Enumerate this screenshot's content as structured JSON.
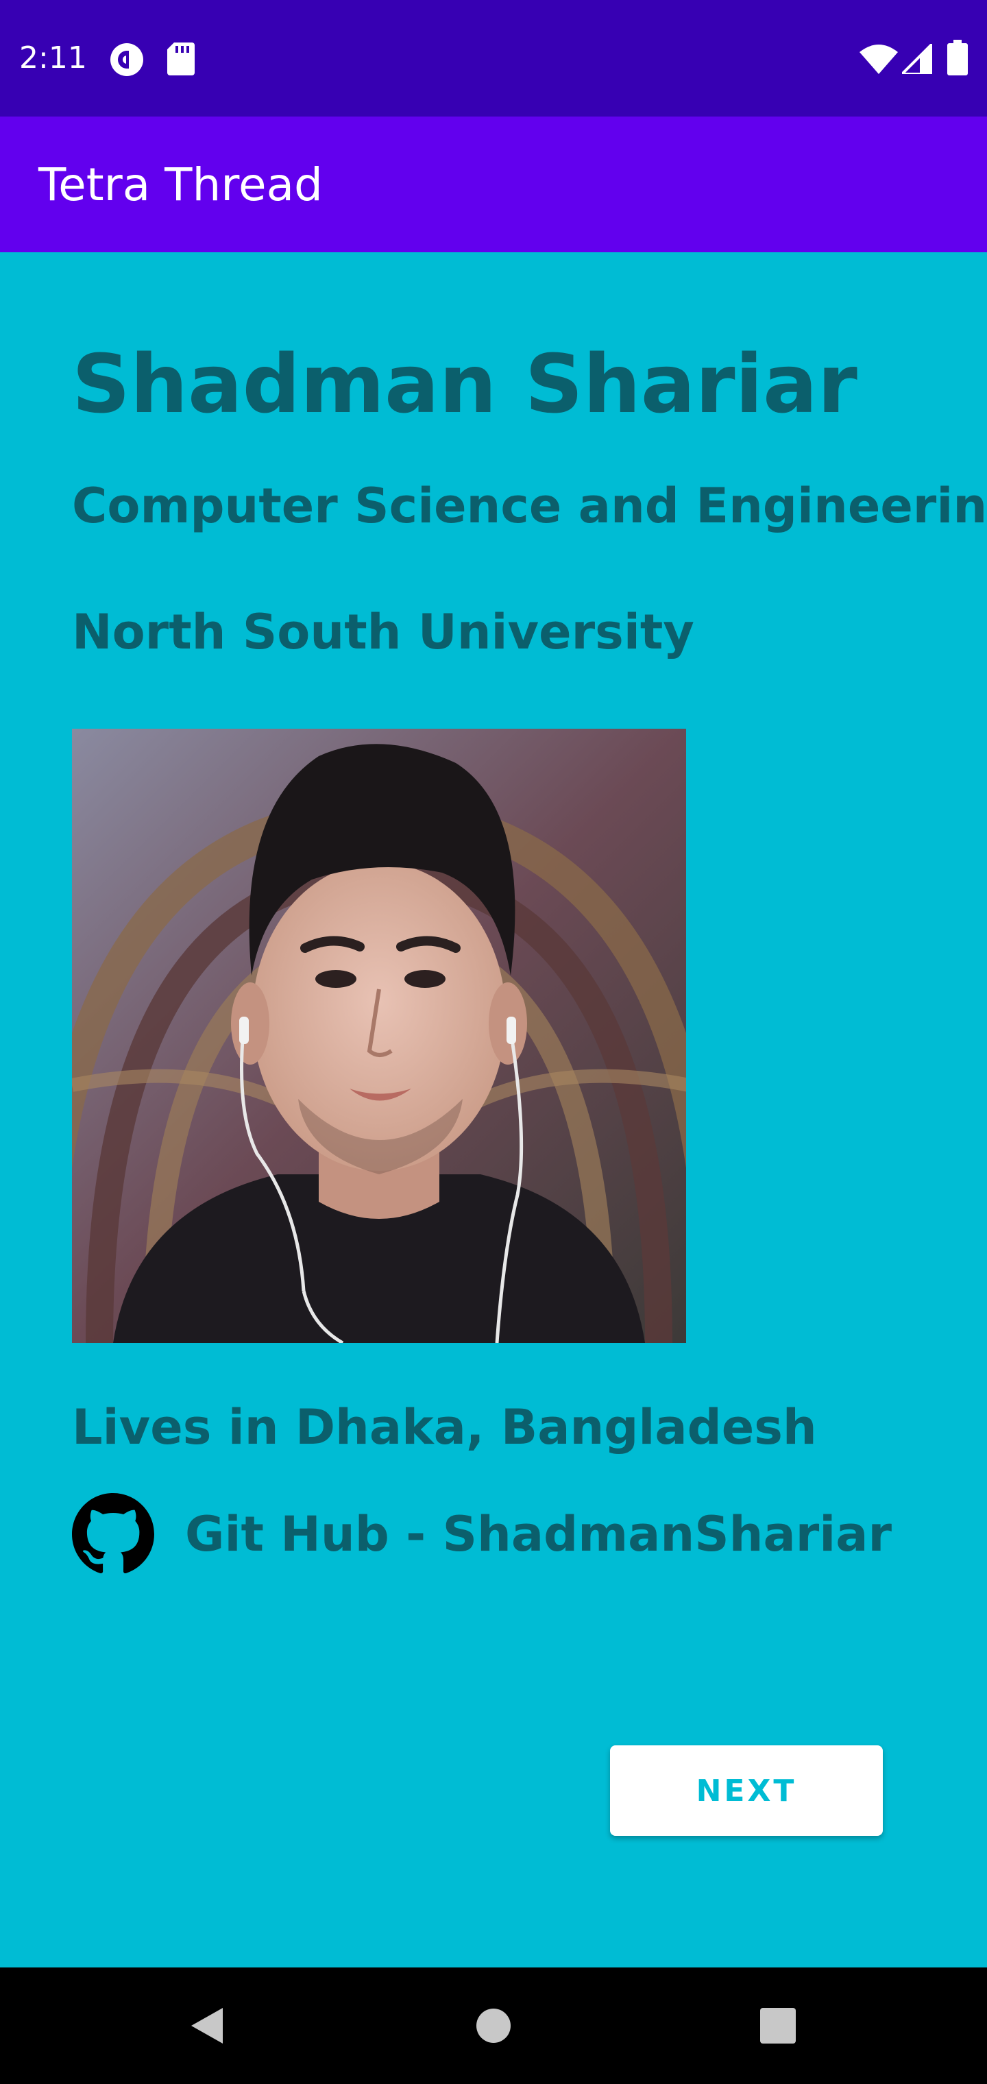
{
  "status_bar": {
    "time": "2:11",
    "left_icons": [
      "pocket-casts-icon",
      "sd-card-icon"
    ],
    "right_icons": [
      "wifi-icon",
      "signal-icon",
      "battery-icon"
    ]
  },
  "app_bar": {
    "title": "Tetra Thread"
  },
  "profile": {
    "name": "Shadman Shariar",
    "department": "Computer Science and Engineering",
    "university": "North South University",
    "photo_alt": "profile-photo",
    "location": "Lives in Dhaka, Bangladesh",
    "github_label": "Git Hub - ShadmanShariar"
  },
  "actions": {
    "next_label": "NEXT"
  },
  "nav_bar": {
    "buttons": [
      "back-icon",
      "home-icon",
      "recents-icon"
    ]
  },
  "colors": {
    "status_bar": "#3700B3",
    "app_bar": "#6200EE",
    "background": "#00BCD4",
    "text": "#0B5F6C",
    "button_bg": "#FFFFFF",
    "button_text": "#00BCD4"
  }
}
